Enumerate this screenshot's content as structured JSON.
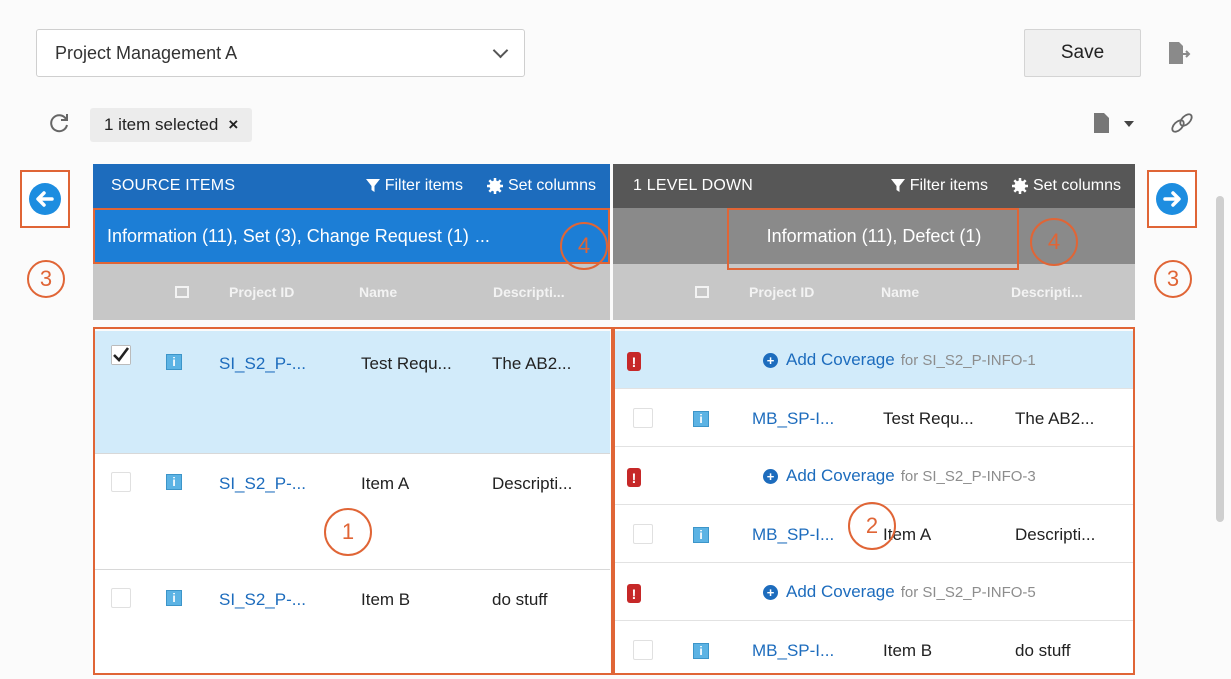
{
  "toolbar": {
    "project_select": "Project Management A",
    "save_label": "Save",
    "selection_text": "1 item selected",
    "clear_symbol": "×"
  },
  "left_panel": {
    "title": "SOURCE ITEMS",
    "filter_label": "Filter items",
    "columns_label": "Set columns",
    "summary": "Information (11), Set (3), Change Request (1)",
    "summary_more": "...",
    "headers": [
      "Project ID",
      "Name",
      "Descripti..."
    ],
    "rows": [
      {
        "id": "SI_S2_P-...",
        "name": "Test Requ...",
        "desc": "The AB2...",
        "checked": true
      },
      {
        "id": "SI_S2_P-...",
        "name": "Item A",
        "desc": "Descripti...",
        "checked": false
      },
      {
        "id": "SI_S2_P-...",
        "name": "Item B",
        "desc": "do stuff",
        "checked": false
      }
    ]
  },
  "right_panel": {
    "title": "1 LEVEL DOWN",
    "filter_label": "Filter items",
    "columns_label": "Set columns",
    "summary": "Information (11), Defect (1)",
    "headers": [
      "Project ID",
      "Name",
      "Descripti..."
    ],
    "groups": [
      {
        "add_label": "Add Coverage",
        "for_text": "for SI_S2_P-INFO-1",
        "row": {
          "id": "MB_SP-I...",
          "name": "Test Requ...",
          "desc": "The AB2..."
        }
      },
      {
        "add_label": "Add Coverage",
        "for_text": "for SI_S2_P-INFO-3",
        "row": {
          "id": "MB_SP-I...",
          "name": "Item A",
          "desc": "Descripti..."
        }
      },
      {
        "add_label": "Add Coverage",
        "for_text": "for SI_S2_P-INFO-5",
        "row": {
          "id": "MB_SP-I...",
          "name": "Item B",
          "desc": "do stuff"
        }
      }
    ]
  },
  "annotations": {
    "m1": "1",
    "m2": "2",
    "m3": "3",
    "m4": "4"
  },
  "colors": {
    "source_header": "#1d6cbd",
    "level_header": "#575757",
    "annotation": "#e06536",
    "info_icon": "#5cb3e4",
    "warning": "#c62828"
  }
}
